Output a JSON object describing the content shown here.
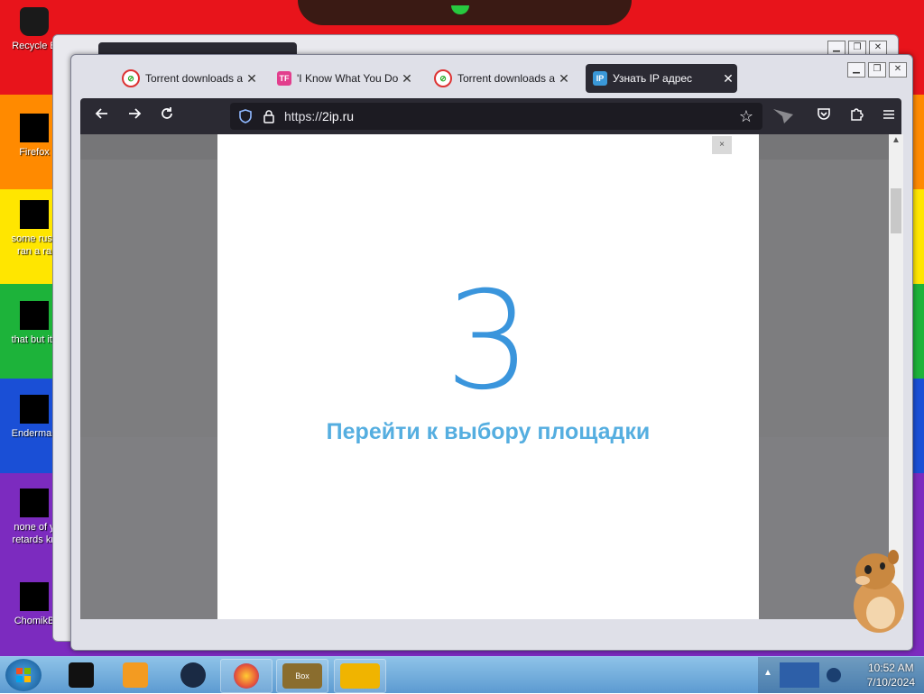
{
  "desktop": {
    "icons": [
      {
        "label": "Recycle B",
        "lines": [
          "Recycle B"
        ]
      },
      {
        "label": "Firefox",
        "lines": [
          "Firefox"
        ]
      },
      {
        "label": "some russ ran a ra",
        "lines": [
          "some russ",
          "ran a ra"
        ]
      },
      {
        "label": "that but its",
        "lines": [
          "that but its"
        ]
      },
      {
        "label": "Enderman",
        "lines": [
          "Enderman"
        ]
      },
      {
        "label": "none of y retards kn",
        "lines": [
          "none of y",
          "retards kn"
        ]
      },
      {
        "label": "ChomikB",
        "lines": [
          "ChomikB"
        ]
      }
    ]
  },
  "browser": {
    "tabs": [
      {
        "title": "Torrent downloads and",
        "icon": "torrent-favicon",
        "active": false
      },
      {
        "title": "'I Know What You Dow",
        "icon": "tf-favicon",
        "active": false
      },
      {
        "title": "Torrent downloads and",
        "icon": "torrent-favicon",
        "active": false
      },
      {
        "title": "Узнать IP адрес",
        "icon": "ip-favicon",
        "active": true
      }
    ],
    "tab_favicon_text": {
      "tf": "TF",
      "ip": "IP"
    },
    "close_glyph": "✕",
    "url": {
      "scheme": "https://",
      "host": "2ip.ru"
    },
    "window_controls": {
      "minimize": "▁",
      "maximize": "❐",
      "close": "✕"
    }
  },
  "modal": {
    "close_label": "×",
    "countdown": "3",
    "message": "Перейти к выбору площадки"
  },
  "taskbar": {
    "clock_time": "10:52 AM",
    "clock_date": "7/10/2024",
    "apps": [
      "terminal-app",
      "media-player-app",
      "globe-app",
      "firefox-app",
      "box-game-app",
      "folder-app"
    ],
    "box_label": "Box"
  },
  "colors": {
    "modal_number": "#3a95dc",
    "modal_text": "#55aee0",
    "browser_chrome": "#2b2a33"
  }
}
